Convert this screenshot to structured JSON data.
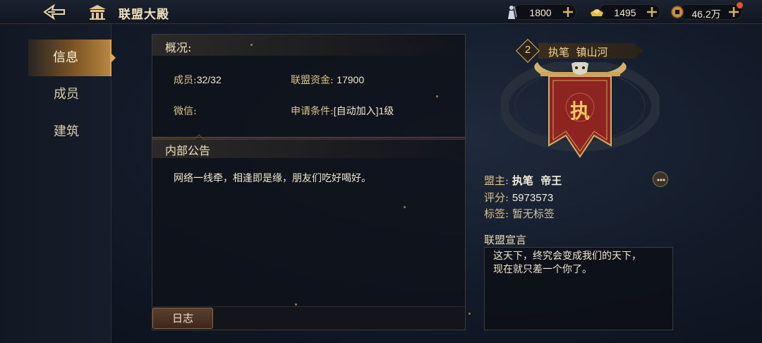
{
  "header": {
    "title": "联盟大殿",
    "resources": [
      {
        "name": "troops",
        "icon": "soldier-icon",
        "value": "1800"
      },
      {
        "name": "gold",
        "icon": "gold-ingot-icon",
        "value": "1495"
      },
      {
        "name": "coins",
        "icon": "copper-coin-icon",
        "value": "46.2万"
      }
    ]
  },
  "sidebar": {
    "items": [
      {
        "label": "信息",
        "active": true
      },
      {
        "label": "成员",
        "active": false
      },
      {
        "label": "建筑",
        "active": false
      }
    ]
  },
  "overview": {
    "heading": "概况:",
    "members_label": "成员:",
    "members_value": "32/32",
    "funds_label": "联盟资金:",
    "funds_value": "17900",
    "wechat_label": "微信:",
    "wechat_value": "",
    "join_label": "申请条件:",
    "join_value": "[自动加入]1级"
  },
  "announcement": {
    "heading": "内部公告",
    "text": "网络一线牵，相逢即是缘，朋友们吃好喝好。"
  },
  "footer": {
    "log_button": "日志"
  },
  "alliance": {
    "rank": "2",
    "name": "执笔  镇山河",
    "banner_char": "执",
    "leader_label": "盟主:",
    "leader_value": "执笔  帝王",
    "score_label": "评分:",
    "score_value": "5973573",
    "tags_label": "标签:",
    "tags_value": "暂无标签",
    "declaration_title": "联盟宣言",
    "declaration_line1": "这天下，终究会变成我们的天下，",
    "declaration_line2": "现在就只差一个你了。"
  },
  "colors": {
    "gold": "#d9c38a",
    "banner_red": "#8e2420",
    "accent": "#b78640"
  }
}
